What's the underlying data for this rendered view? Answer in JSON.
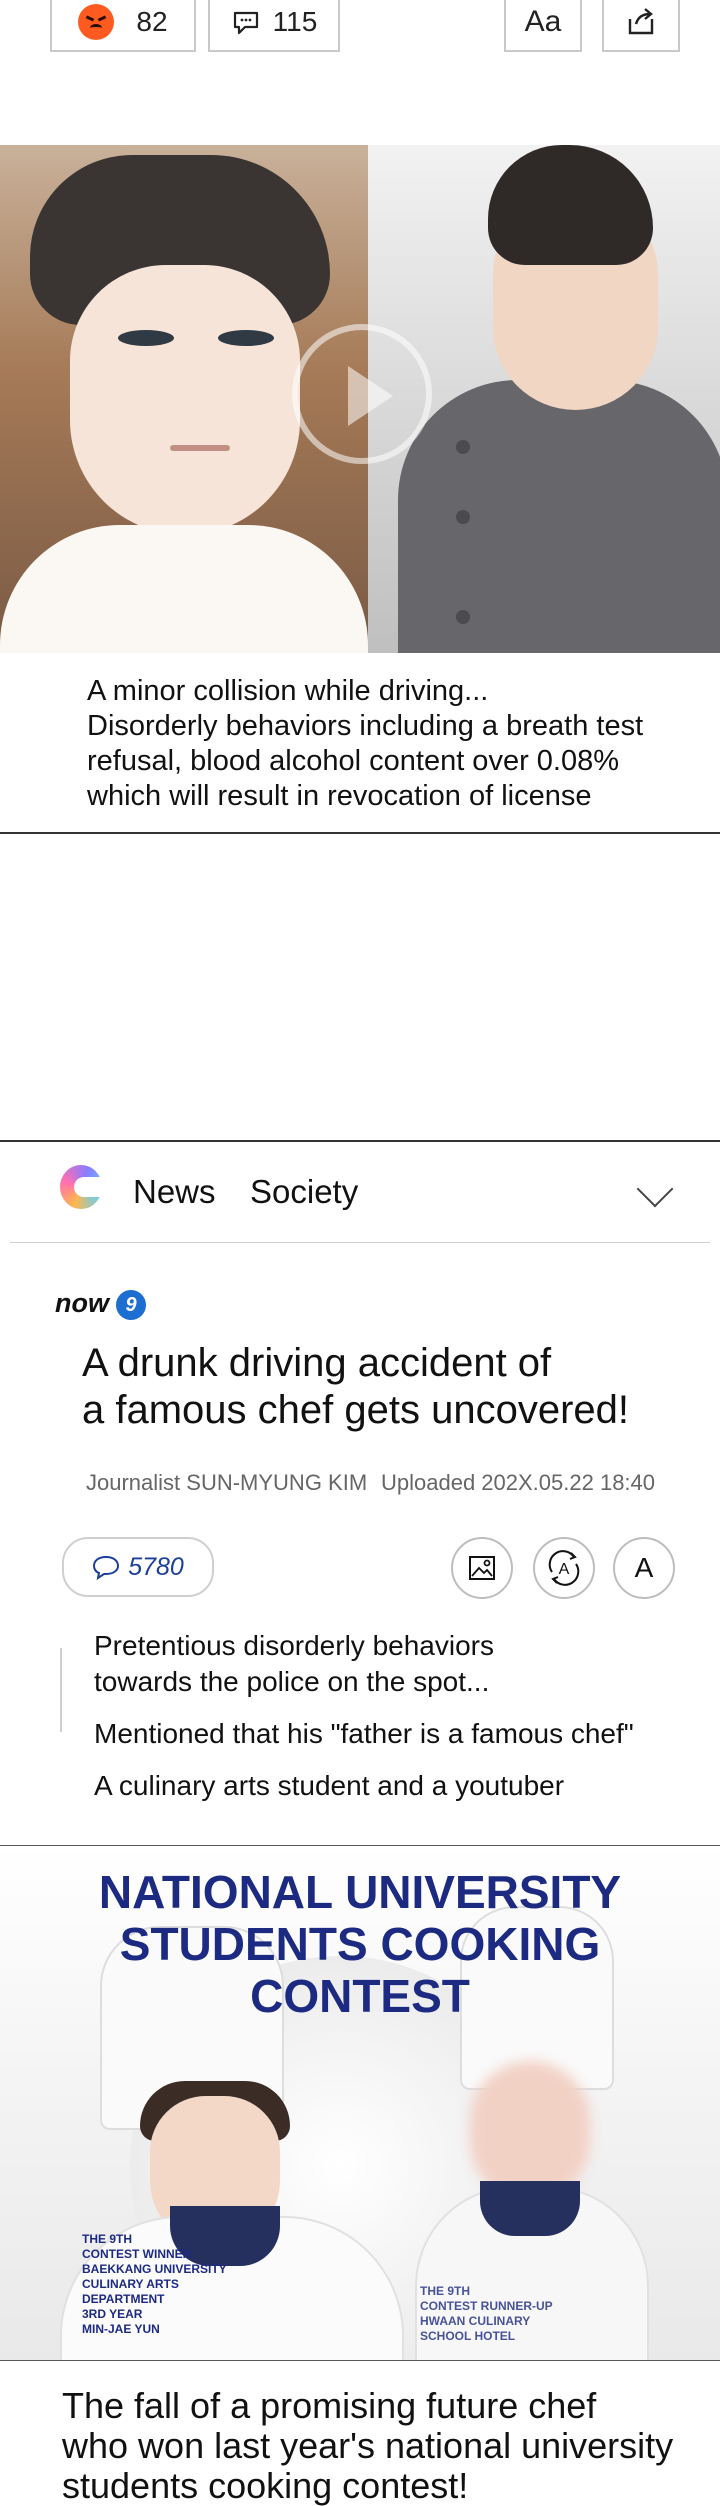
{
  "reactions": {
    "count": "82",
    "comments": "115"
  },
  "toolbar": {
    "font_size_label": "Aa"
  },
  "comic": {
    "caption_lines": [
      "A minor collision while driving...",
      "Disorderly behaviors including a breath test",
      "refusal, blood alcohol content over 0.08%",
      "which will result in revocation of license"
    ]
  },
  "news_header": {
    "tab_news": "News",
    "tab_society": "Society"
  },
  "article": {
    "brand": "now",
    "brand_badge": "9",
    "headline_lines": [
      "A drunk driving accident of",
      "a famous chef gets uncovered!"
    ],
    "journalist": "Journalist SUN-MYUNG KIM",
    "uploaded": "Uploaded 202X.05.22  18:40",
    "comment_count": "5780",
    "text_size_label": "A",
    "quotes": [
      "Pretentious disorderly behaviors",
      "towards the police on the spot...",
      "Mentioned that his \"father is a famous chef\"",
      "A culinary arts student and a youtuber"
    ]
  },
  "poster": {
    "title_lines": [
      "NATIONAL UNIVERSITY",
      "STUDENTS COOKING",
      "CONTEST"
    ],
    "left_tag_lines": [
      "THE 9TH",
      "CONTEST WINNER",
      "BAEKKANG UNIVERSITY",
      "CULINARY ARTS",
      "DEPARTMENT",
      "3RD YEAR",
      "MIN-JAE YUN"
    ],
    "right_tag_lines": [
      "THE 9TH",
      "CONTEST RUNNER-UP",
      "HWAAN CULINARY",
      "SCHOOL HOTEL"
    ]
  },
  "second_headline_lines": [
    "The fall of a promising future chef",
    "who won last year's national university",
    "students cooking contest!"
  ]
}
